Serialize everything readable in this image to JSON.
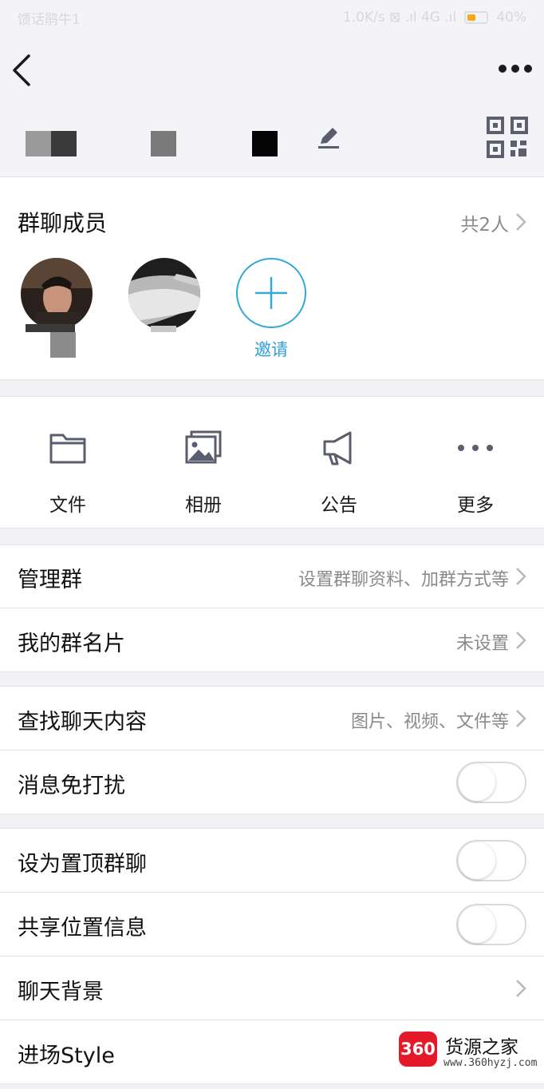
{
  "status_bar": {
    "left_text": "馈话鹃牛1",
    "right_text": "1.0K/s ⊠ .ıl 4G .ıl",
    "battery_text": "40%"
  },
  "group_header": {
    "blurred_name": ""
  },
  "members": {
    "title": "群聊成员",
    "count_label": "共2人",
    "invite_label": "邀请"
  },
  "tools": [
    {
      "label": "文件",
      "icon": "folder-icon"
    },
    {
      "label": "相册",
      "icon": "album-icon"
    },
    {
      "label": "公告",
      "icon": "megaphone-icon"
    },
    {
      "label": "更多",
      "icon": "more-dots-icon"
    }
  ],
  "settings": {
    "manage": {
      "label": "管理群",
      "value": "设置群聊资料、加群方式等"
    },
    "my_card": {
      "label": "我的群名片",
      "value": "未设置"
    },
    "search_chat": {
      "label": "查找聊天内容",
      "value": "图片、视频、文件等"
    },
    "do_not_disturb": {
      "label": "消息免打扰",
      "on": false
    },
    "pin_chat": {
      "label": "设为置顶群聊",
      "on": false
    },
    "share_location": {
      "label": "共享位置信息",
      "on": false
    },
    "chat_background": {
      "label": "聊天背景"
    },
    "entrance_style": {
      "label": "进场Style"
    }
  },
  "watermark": {
    "badge": "360",
    "title": "货源之家",
    "url": "www.360hyzj.com"
  },
  "colors": {
    "accent": "#2e9fd6",
    "watermark_red": "#e4192a",
    "battery": "#f4a81d"
  }
}
